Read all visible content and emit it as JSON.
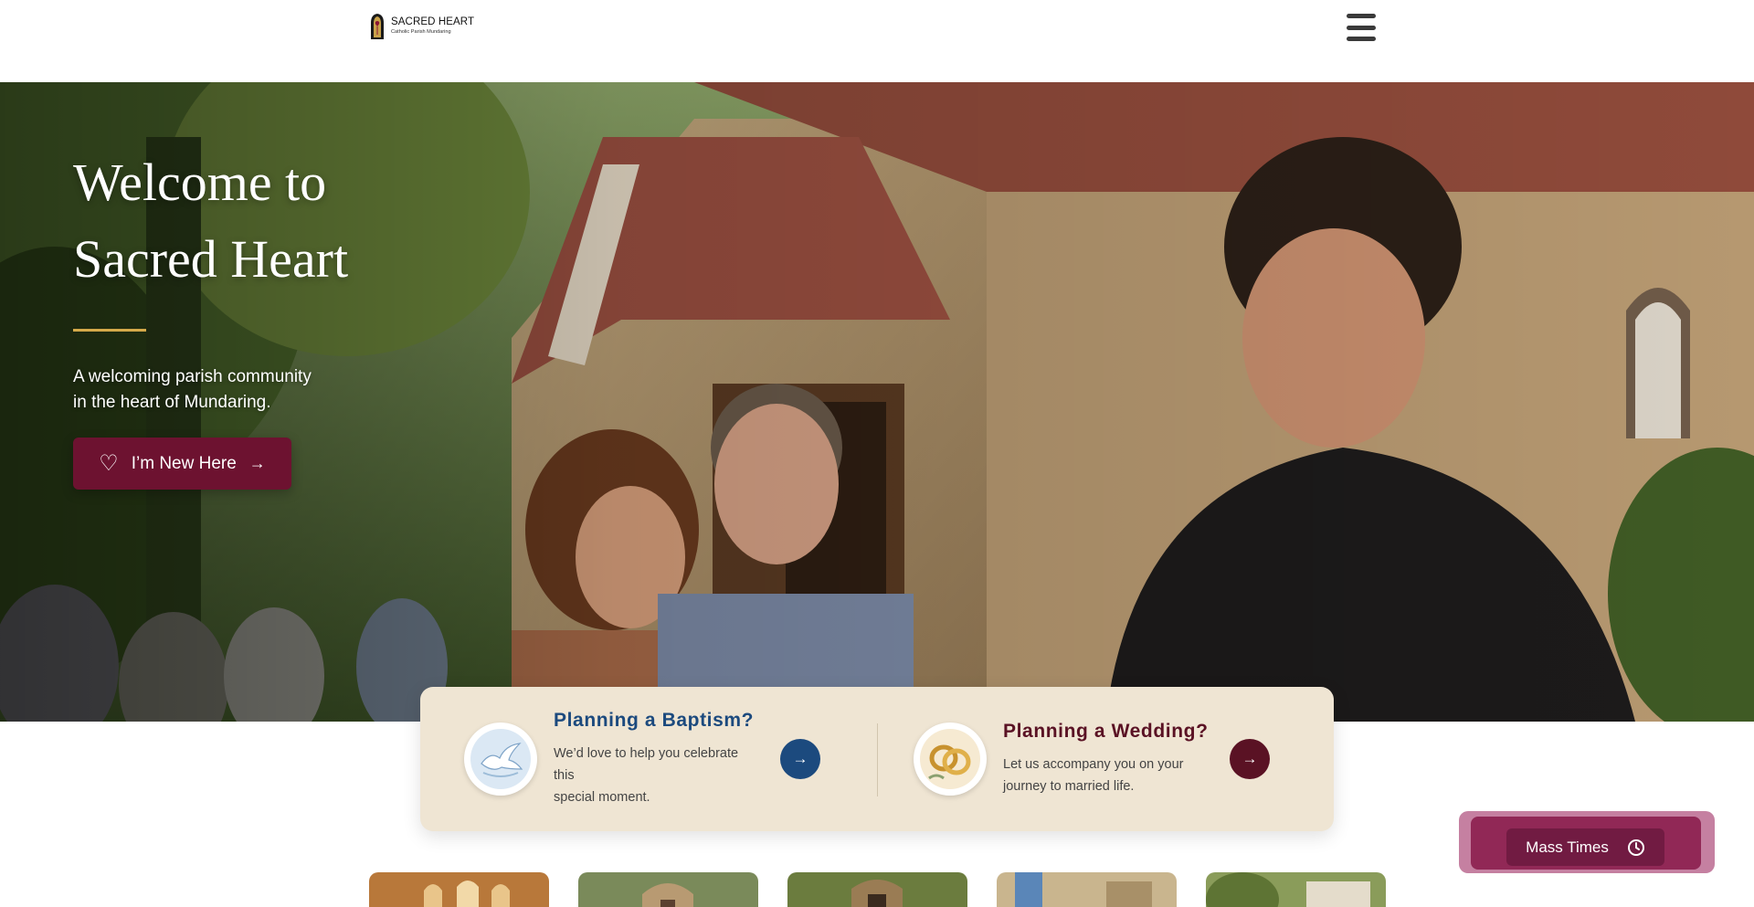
{
  "header": {
    "logo_title": "SACRED HEART",
    "logo_subtitle": "Catholic Parish Mundaring",
    "menu_icon": "hamburger-menu-icon"
  },
  "hero": {
    "title_line1": "Welcome to",
    "title_line2": "Sacred Heart",
    "subtitle_line1": "A welcoming parish community",
    "subtitle_line2": "in the heart of Mundaring.",
    "cta_label": "I’m New Here",
    "cta_icon": "heart-icon",
    "cta_arrow": "→"
  },
  "plans": {
    "baptism": {
      "title": "Planning a Baptism?",
      "desc_line1": "We’d love to help you celebrate this",
      "desc_line2": "special moment.",
      "icon": "dove-icon",
      "arrow": "→"
    },
    "wedding": {
      "title": "Planning a Wedding?",
      "desc_line1": "Let us accompany you on your",
      "desc_line2": "journey to married life.",
      "icon": "wedding-rings-icon",
      "arrow": "→"
    }
  },
  "mass_times": {
    "label": "Mass Times",
    "icon": "clock-icon"
  },
  "colors": {
    "burgundy": "#6d1230",
    "navy": "#1c4a7e",
    "gold": "#d4a94a",
    "cream": "#efe5d3"
  }
}
